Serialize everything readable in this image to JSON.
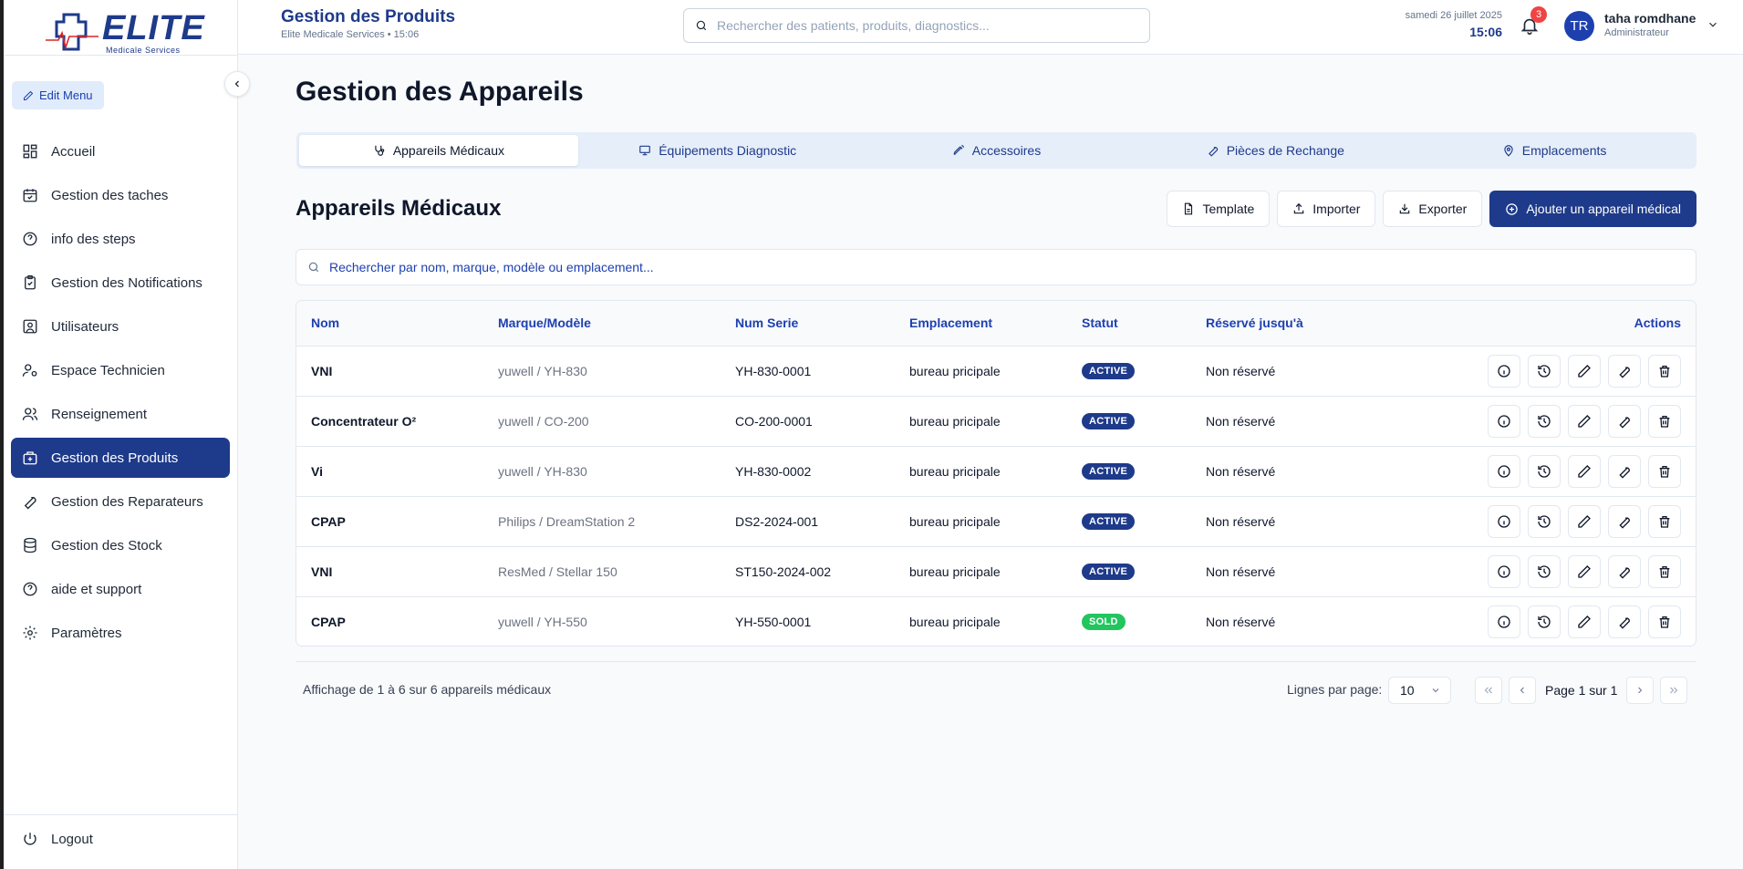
{
  "brand": {
    "name": "ELITE",
    "sub": "Medicale Services"
  },
  "sidebar": {
    "edit_menu": "Edit Menu",
    "items": [
      {
        "label": "Accueil",
        "icon": "dashboard-icon"
      },
      {
        "label": "Gestion des taches",
        "icon": "calendar-check-icon"
      },
      {
        "label": "info des steps",
        "icon": "help-circle-icon"
      },
      {
        "label": "Gestion des Notifications",
        "icon": "clipboard-check-icon"
      },
      {
        "label": "Utilisateurs",
        "icon": "user-square-icon"
      },
      {
        "label": "Espace Technicien",
        "icon": "user-cog-icon"
      },
      {
        "label": "Renseignement",
        "icon": "users-icon"
      },
      {
        "label": "Gestion des Produits",
        "icon": "hospital-bag-icon",
        "active": true
      },
      {
        "label": "Gestion des Reparateurs",
        "icon": "wrench-icon"
      },
      {
        "label": "Gestion des Stock",
        "icon": "database-icon"
      },
      {
        "label": "aide et support",
        "icon": "help-circle-icon"
      },
      {
        "label": "Paramètres",
        "icon": "gear-icon"
      }
    ],
    "logout": "Logout"
  },
  "header": {
    "title": "Gestion des Produits",
    "subtitle": "Elite Medicale Services • 15:06",
    "search_placeholder": "Rechercher des patients, produits, diagnostics...",
    "date": "samedi 26 juillet 2025",
    "time": "15:06",
    "notifications": "3",
    "user": {
      "initials": "TR",
      "name": "taha romdhane",
      "role": "Administrateur"
    }
  },
  "main": {
    "title": "Gestion des Appareils",
    "tabs": [
      {
        "label": "Appareils Médicaux",
        "icon": "stethoscope-icon",
        "active": true
      },
      {
        "label": "Équipements Diagnostic",
        "icon": "monitor-icon"
      },
      {
        "label": "Accessoires",
        "icon": "syringe-icon"
      },
      {
        "label": "Pièces de Rechange",
        "icon": "wrench-icon"
      },
      {
        "label": "Emplacements",
        "icon": "map-pin-icon"
      }
    ],
    "section_title": "Appareils Médicaux",
    "buttons": {
      "template": "Template",
      "import": "Importer",
      "export": "Exporter",
      "add": "Ajouter un appareil médical"
    },
    "table_search_placeholder": "Rechercher par nom, marque, modèle ou emplacement...",
    "table": {
      "headers": [
        "Nom",
        "Marque/Modèle",
        "Num Serie",
        "Emplacement",
        "Statut",
        "Réservé jusqu'à",
        "Actions"
      ],
      "rows": [
        {
          "name": "VNI",
          "brand": "yuwell / YH-830",
          "serial": "YH-830-0001",
          "location": "bureau pricipale",
          "status": "ACTIVE",
          "reserved": "Non réservé"
        },
        {
          "name": "Concentrateur O²",
          "brand": "yuwell / CO-200",
          "serial": "CO-200-0001",
          "location": "bureau pricipale",
          "status": "ACTIVE",
          "reserved": "Non réservé"
        },
        {
          "name": "Vi",
          "brand": "yuwell / YH-830",
          "serial": "YH-830-0002",
          "location": "bureau pricipale",
          "status": "ACTIVE",
          "reserved": "Non réservé"
        },
        {
          "name": "CPAP",
          "brand": "Philips / DreamStation 2",
          "serial": "DS2-2024-001",
          "location": "bureau pricipale",
          "status": "ACTIVE",
          "reserved": "Non réservé"
        },
        {
          "name": "VNI",
          "brand": "ResMed / Stellar 150",
          "serial": "ST150-2024-002",
          "location": "bureau pricipale",
          "status": "ACTIVE",
          "reserved": "Non réservé"
        },
        {
          "name": "CPAP",
          "brand": "yuwell / YH-550",
          "serial": "YH-550-0001",
          "location": "bureau pricipale",
          "status": "SOLD",
          "reserved": "Non réservé"
        }
      ]
    },
    "footer": {
      "info": "Affichage de 1 à 6 sur 6 appareils médicaux",
      "rows_label": "Lignes par page:",
      "rows_value": "10",
      "page_text": "Page 1 sur 1"
    }
  },
  "colors": {
    "primary": "#1e3a8a",
    "accent": "#1e40af",
    "sold": "#22c55e",
    "badge": "#ef4444"
  }
}
